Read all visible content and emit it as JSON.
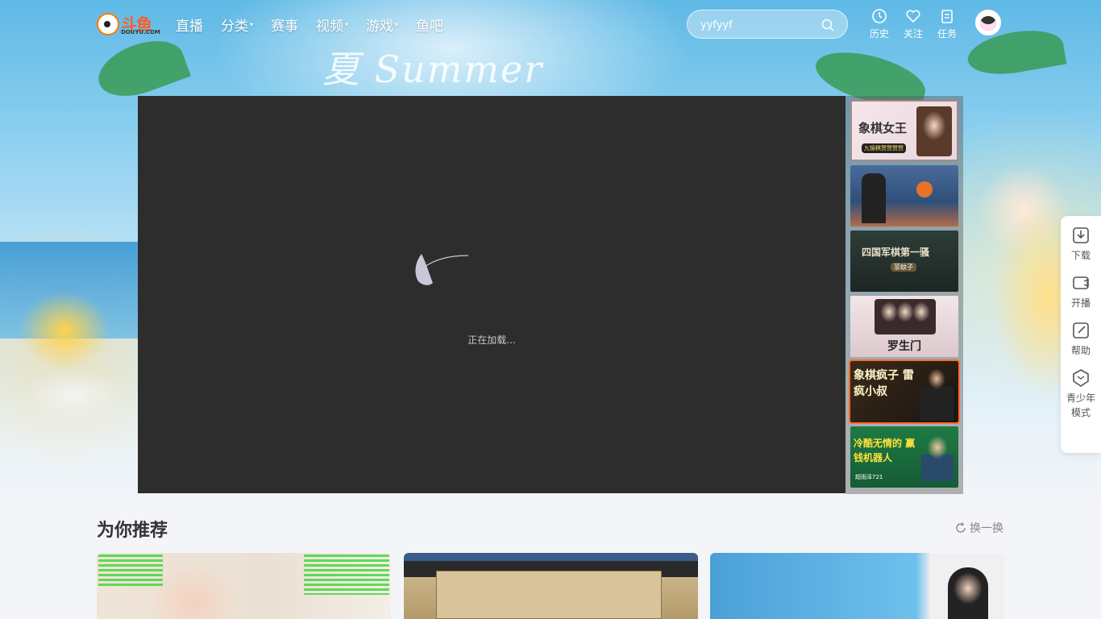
{
  "brand": {
    "name": "斗鱼",
    "sub": "DOUYU.COM"
  },
  "nav": [
    {
      "label": "直播",
      "dropdown": false
    },
    {
      "label": "分类",
      "dropdown": true
    },
    {
      "label": "赛事",
      "dropdown": false
    },
    {
      "label": "视频",
      "dropdown": true
    },
    {
      "label": "游戏",
      "dropdown": true
    },
    {
      "label": "鱼吧",
      "dropdown": false
    }
  ],
  "search": {
    "value": "yyfyyf",
    "icon": "search-icon"
  },
  "top_actions": [
    {
      "label": "历史",
      "icon": "clock-icon"
    },
    {
      "label": "关注",
      "icon": "heart-icon"
    },
    {
      "label": "任务",
      "icon": "clipboard-icon"
    }
  ],
  "player": {
    "loading_text": "正在加载..."
  },
  "thumbnails": [
    {
      "title": "象棋女王",
      "caption": "九锦棋赞赞赞赞"
    },
    {
      "title": "",
      "caption": ""
    },
    {
      "title": "四国军棋第一骚",
      "caption": "菲蚊子"
    },
    {
      "title": "罗生门",
      "caption": ""
    },
    {
      "title": "象棋疯子 雷疯小叔",
      "caption": ""
    },
    {
      "title": "冷酷无情的 赢钱机器人",
      "caption": "超雨泽721"
    }
  ],
  "sidetools": [
    {
      "label": "下载",
      "icon": "download-icon"
    },
    {
      "label": "开播",
      "icon": "camera-icon"
    },
    {
      "label": "帮助",
      "icon": "edit-icon"
    },
    {
      "label": "青少年模式",
      "icon": "shield-icon"
    }
  ],
  "recommend": {
    "title": "为你推荐",
    "refresh_label": "换一换"
  },
  "colors": {
    "accent": "#ff5d23",
    "player_bg": "#2d2d2d"
  }
}
